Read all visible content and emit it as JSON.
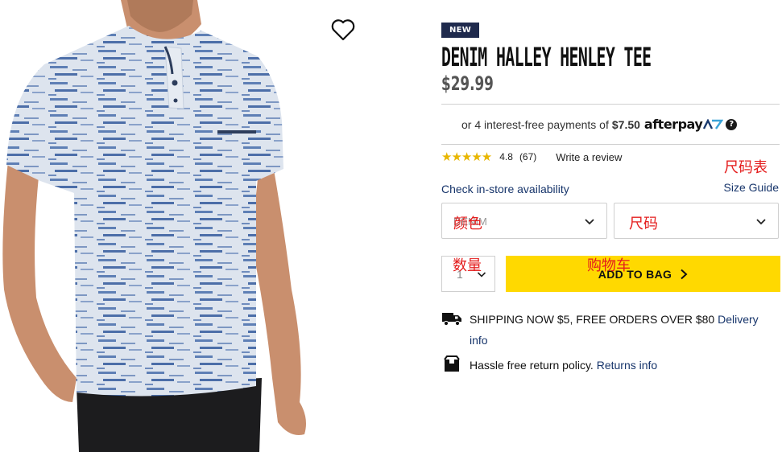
{
  "product": {
    "badge": "NEW",
    "title": "DENIM HALLEY HENLEY TEE",
    "price": "$29.99"
  },
  "afterpay": {
    "prefix": "or 4 interest-free payments of",
    "amount": "$7.50",
    "brand": "afterpay",
    "help": "?"
  },
  "rating": {
    "stars": "★★★★★",
    "score": "4.8",
    "count": "(67)",
    "write_review": "Write a review"
  },
  "annotations": {
    "size_chart": "尺码表",
    "color": "颜色",
    "size": "尺码",
    "quantity": "数量",
    "cart": "购物车"
  },
  "store": {
    "check_availability": "Check in-store availability",
    "size_guide": "Size Guide"
  },
  "options": {
    "color_placeholder": "DENIM",
    "size_placeholder": "",
    "quantity": "1"
  },
  "cart": {
    "add_label": "ADD TO BAG"
  },
  "shipping": {
    "text": "SHIPPING NOW $5, FREE ORDERS OVER $80",
    "link": "Delivery info"
  },
  "returns": {
    "text": "Hassle free return policy.",
    "link": "Returns info"
  },
  "colors": {
    "brand_navy": "#1f2a4d",
    "link_blue": "#17356b",
    "cta_yellow": "#ffd900",
    "star_gold": "#e8b600",
    "annotation_red": "#e41c1c"
  }
}
